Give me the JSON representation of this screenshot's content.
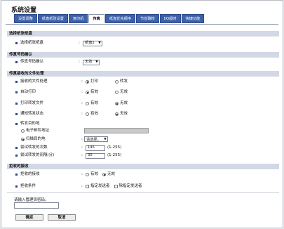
{
  "page_title": "系统设置",
  "tabs": [
    "设置调整",
    "纸盘纸张设置",
    "复印机",
    "传真",
    "纸盘优先顺序",
    "节省碳粉",
    "I/O超时",
    "快捷功能"
  ],
  "sections": {
    "tray": {
      "title": "选择纸张纸盘",
      "row_label": "选择纸张纸盘",
      "select_value": "纸盘1"
    },
    "fax_number": {
      "title": "传真号码确认",
      "row_label": "传真号码确认",
      "select_value": "无效"
    },
    "received_file": {
      "title": "传真接收的文件处理",
      "rows": [
        {
          "label": "接收的文件处理",
          "opt1": "打印",
          "opt2": "转发",
          "selected": 1
        },
        {
          "label": "自动打印",
          "opt1": "有效",
          "opt2": "无效",
          "selected": 1
        },
        {
          "label": "打印转发文件",
          "opt1": "有效",
          "opt2": "无效",
          "selected": 2
        },
        {
          "label": "通知转发状态",
          "opt1": "有效",
          "opt2": "无效",
          "selected": 2
        }
      ],
      "forward_dest_label": "转发目的地",
      "email_label": "电子邮件地址",
      "scan_dest_label": "扫描目的地",
      "scan_dest_select": "请选择。",
      "retry_count_label": "尝试转发的次数",
      "retry_count_value": "145",
      "retry_count_range": "(1-255)",
      "retry_interval_label": "尝试转发的间隔(分)",
      "retry_interval_value": "30",
      "retry_interval_range": "(1-255)"
    },
    "reject": {
      "title": "拒收的接收",
      "row1_label": "拒收的接收",
      "row1_opt1": "有效",
      "row1_opt2": "无效",
      "row2_label": "拒收条件",
      "row2_opt1": "指定发送者",
      "row2_opt2": "除指定发送者"
    }
  },
  "admin_password_label": "请输入管理员密码。",
  "buttons": {
    "ok": "确定",
    "cancel": "取消"
  },
  "colors": {
    "tab_bg": "#3e61a8",
    "section_bg": "#d3d8e6",
    "bullet": "#2b4a8c"
  }
}
